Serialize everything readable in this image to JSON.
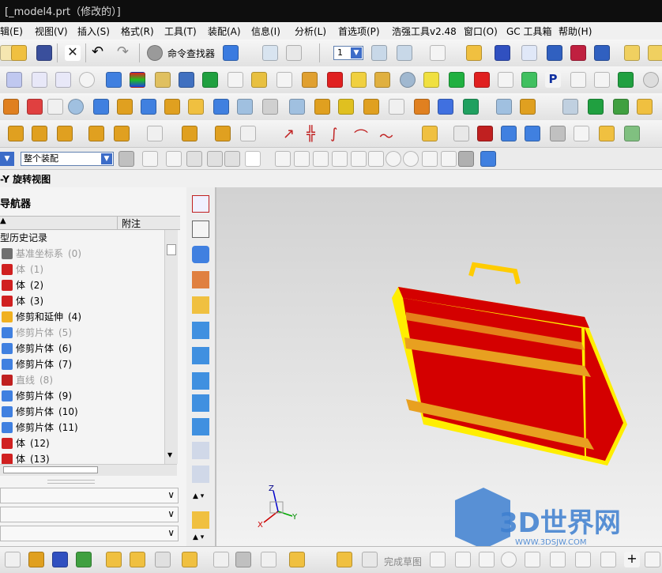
{
  "window": {
    "title": "[_model4.prt（修改的）]"
  },
  "menu": [
    "辑(E)",
    "视图(V)",
    "插入(S)",
    "格式(R)",
    "工具(T)",
    "装配(A)",
    "信息(I)",
    "分析(L)",
    "首选项(P)",
    "浩强工具v2.48",
    "窗口(O)",
    "GC 工具箱",
    "帮助(H)"
  ],
  "toolbar": {
    "command_finder": "命令查找器",
    "layer_value": "1",
    "assembly_filter": "整个装配",
    "finish_sketch": "完成草图"
  },
  "viewbar": {
    "label": "-Y 旋转视图"
  },
  "navigator": {
    "title": "导航器",
    "col_note": "附注",
    "root": "型历史记录",
    "items": [
      {
        "label": "基准坐标系",
        "num": "(0)",
        "dim": true,
        "icon": "datum-csys-icon"
      },
      {
        "label": "体",
        "num": "(1)",
        "dim": true,
        "icon": "body-icon"
      },
      {
        "label": "体",
        "num": "(2)",
        "dim": false,
        "icon": "body-icon"
      },
      {
        "label": "体",
        "num": "(3)",
        "dim": false,
        "icon": "body-icon"
      },
      {
        "label": "修剪和延伸",
        "num": "(4)",
        "dim": false,
        "icon": "trim-extend-icon"
      },
      {
        "label": "修剪片体",
        "num": "(5)",
        "dim": true,
        "icon": "trim-sheet-icon"
      },
      {
        "label": "修剪片体",
        "num": "(6)",
        "dim": false,
        "icon": "trim-sheet-icon"
      },
      {
        "label": "修剪片体",
        "num": "(7)",
        "dim": false,
        "icon": "trim-sheet-icon"
      },
      {
        "label": "直线",
        "num": "(8)",
        "dim": true,
        "icon": "line-icon"
      },
      {
        "label": "修剪片体",
        "num": "(9)",
        "dim": false,
        "icon": "trim-sheet-icon"
      },
      {
        "label": "修剪片体",
        "num": "(10)",
        "dim": false,
        "icon": "trim-sheet-icon"
      },
      {
        "label": "修剪片体",
        "num": "(11)",
        "dim": false,
        "icon": "trim-sheet-icon"
      },
      {
        "label": "体",
        "num": "(12)",
        "dim": false,
        "icon": "body-icon"
      },
      {
        "label": "体",
        "num": "(13)",
        "dim": false,
        "icon": "body-icon"
      }
    ]
  },
  "triad": {
    "x": "X",
    "y": "Y",
    "z": "Z"
  },
  "watermark": {
    "text": "3D世界网",
    "url": "WWW.3DSJW.COM"
  },
  "colors": {
    "case_red": "#d40000",
    "case_yellow": "#ffee00",
    "strap": "#e8a020",
    "viewport_top": "#d2d2d2",
    "viewport_bottom": "#f2f2f2"
  }
}
